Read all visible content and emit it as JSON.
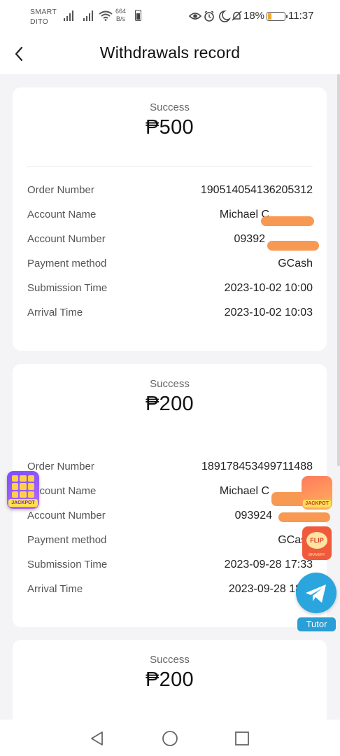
{
  "status_bar": {
    "carrier_line1": "SMART",
    "carrier_line2": "DITO",
    "net_speed_value": "664",
    "net_speed_unit": "B/s",
    "battery_percent": "18%",
    "time": "11:37",
    "icons": [
      "signal-icon",
      "signal-icon",
      "wifi-icon",
      "battery-saver-icon",
      "eye-icon",
      "alarm-icon",
      "moon-icon",
      "mute-bell-icon",
      "battery-icon"
    ]
  },
  "header": {
    "title": "Withdrawals record",
    "back_icon": "chevron-left-icon"
  },
  "records": [
    {
      "status": "Success",
      "amount": "₱500",
      "rows": [
        {
          "label": "Order Number",
          "value": "190514054136205312"
        },
        {
          "label": "Account Name",
          "value": "Michael C"
        },
        {
          "label": "Account Number",
          "value": "09392"
        },
        {
          "label": "Payment method",
          "value": "GCash"
        },
        {
          "label": "Submission Time",
          "value": "2023-10-02 10:00"
        },
        {
          "label": "Arrival Time",
          "value": "2023-10-02 10:03"
        }
      ]
    },
    {
      "status": "Success",
      "amount": "₱200",
      "rows": [
        {
          "label": "Order Number",
          "value": "189178453499711488"
        },
        {
          "label": "Account Name",
          "value": "Michael C"
        },
        {
          "label": "Account Number",
          "value": "093924"
        },
        {
          "label": "Payment method",
          "value": "GCash"
        },
        {
          "label": "Submission Time",
          "value": "2023-09-28 17:33"
        },
        {
          "label": "Arrival Time",
          "value": "2023-09-28 18"
        }
      ]
    },
    {
      "status": "Success",
      "amount": "₱200"
    }
  ],
  "floating": {
    "jackpot_label": "JACKPOT",
    "flip_label": "FLIP",
    "flip_sub": "BRAVERY",
    "tutor_label": "Tutor",
    "telegram_icon": "telegram-icon"
  },
  "nav": {
    "icons": [
      "back-triangle-icon",
      "home-circle-icon",
      "recents-square-icon"
    ]
  },
  "colors": {
    "redaction": "#f7944a",
    "telegram": "#2aa5de",
    "battery_low": "#f0a92a"
  }
}
